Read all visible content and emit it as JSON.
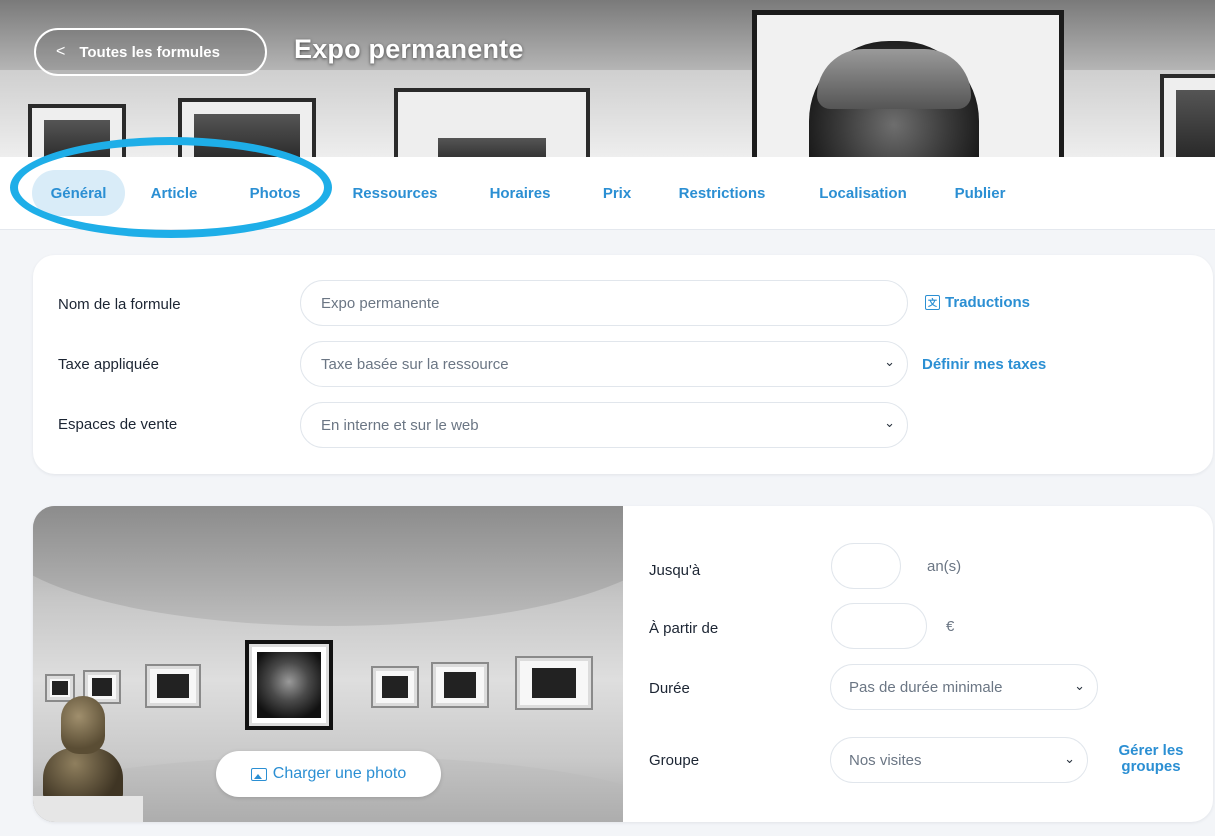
{
  "header": {
    "back_label": "Toutes les formules",
    "back_icon": "chevron-left-icon",
    "title": "Expo permanente"
  },
  "tabs": [
    {
      "label": "Général",
      "active": true
    },
    {
      "label": "Article",
      "active": false
    },
    {
      "label": "Photos",
      "active": false
    },
    {
      "label": "Ressources",
      "active": false
    },
    {
      "label": "Horaires",
      "active": false
    },
    {
      "label": "Prix",
      "active": false
    },
    {
      "label": "Restrictions",
      "active": false
    },
    {
      "label": "Localisation",
      "active": false
    },
    {
      "label": "Publier",
      "active": false
    }
  ],
  "general": {
    "name_label": "Nom de la formule",
    "name_value": "Expo permanente",
    "translations_link": "Traductions",
    "tax_label": "Taxe appliquée",
    "tax_value": "Taxe basée sur la ressource",
    "tax_link": "Définir mes taxes",
    "sales_label": "Espaces de vente",
    "sales_value": "En interne et sur le web"
  },
  "details": {
    "upload_label": "Charger une photo",
    "until_label": "Jusqu'à",
    "until_unit": "an(s)",
    "from_label": "À partir de",
    "from_unit": "€",
    "duration_label": "Durée",
    "duration_value": "Pas de durée minimale",
    "group_label": "Groupe",
    "group_value": "Nos visites",
    "manage_groups": "Gérer les groupes"
  },
  "colors": {
    "accent": "#2b8fd3",
    "active_tab_bg": "#d9ecf8",
    "annotation": "#1eaee8"
  }
}
